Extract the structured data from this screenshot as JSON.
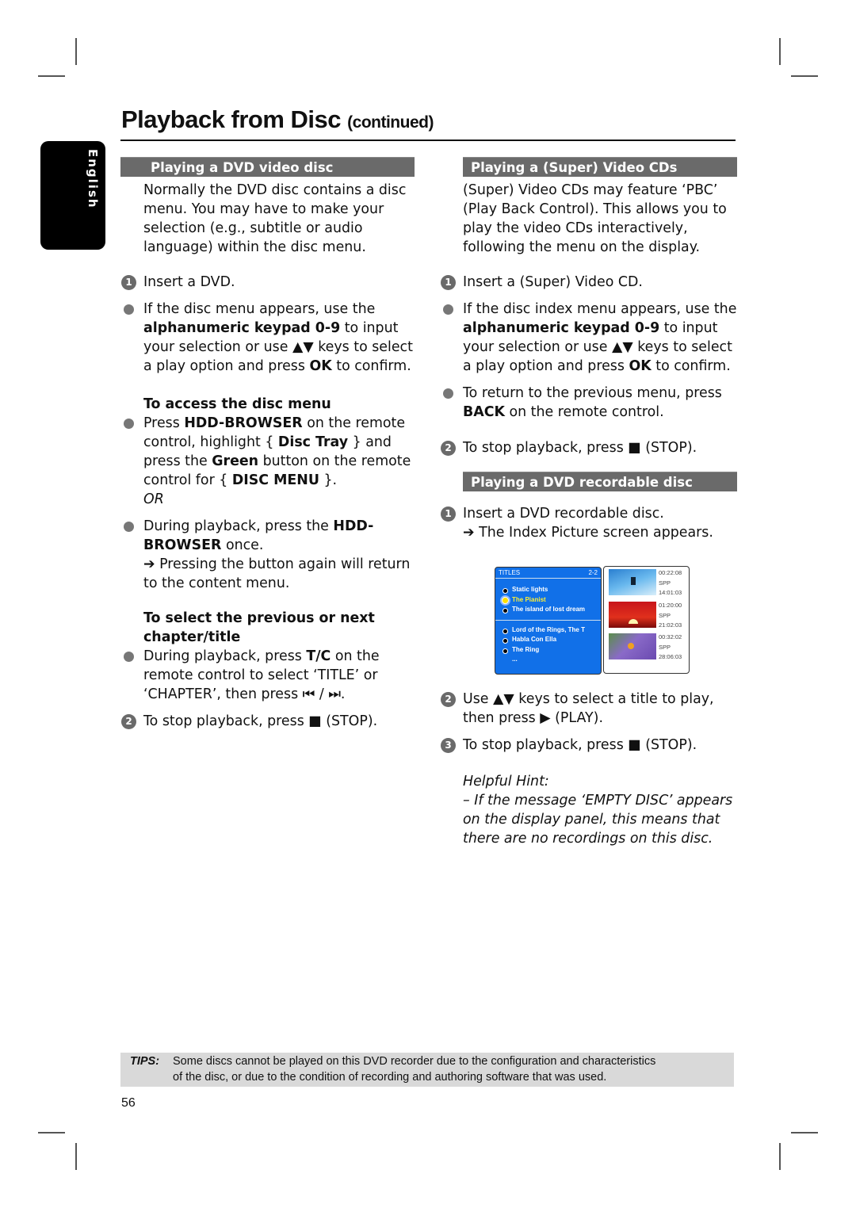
{
  "page": {
    "title": "Playback from Disc",
    "title_suffix": "(continued)",
    "language_tab": "English",
    "page_number": "56"
  },
  "left": {
    "header": "Playing a DVD video disc",
    "intro": "Normally the DVD disc contains a disc menu. You may have to make your selection (e.g., subtitle or audio language) within the disc menu.",
    "step1": "Insert a DVD.",
    "bullet1": {
      "pre": "If the disc menu appears, use the ",
      "b1": "alphanumeric keypad 0-9",
      "mid": " to input your selection or use ▲▼ keys to select a play option and press ",
      "b2": "OK",
      "post": " to confirm."
    },
    "sub1": "To access the disc menu",
    "bullet2": {
      "pre": "Press ",
      "b1": "HDD-BROWSER",
      "m1": " on the remote control, highlight { ",
      "b2": "Disc Tray",
      "m2": " } and press the ",
      "b3": "Green",
      "m3": " button on the remote control for { ",
      "b4": "DISC MENU",
      "post": " }."
    },
    "or": "OR",
    "bullet3": {
      "pre": "During playback, press the ",
      "b1": "HDD-BROWSER",
      "post": " once."
    },
    "bullet3_result": "➔ Pressing the button again will return to the content menu.",
    "sub2": "To select the previous or next chapter/title",
    "bullet4": {
      "pre": "During playback, press ",
      "b1": "T/C",
      "post": " on the remote control to select ‘TITLE’ or ‘CHAPTER’, then press ⏮ / ⏭."
    },
    "step2": "To stop playback, press ■ (STOP)."
  },
  "right": {
    "header": "Playing a (Super) Video CDs",
    "intro": "(Super) Video CDs may feature ‘PBC’ (Play Back Control). This allows you to play the video CDs interactively, following the menu on the display.",
    "step1": "Insert a (Super) Video CD.",
    "bullet1": {
      "pre": "If the disc index menu appears, use the ",
      "b1": "alphanumeric keypad 0-9",
      "mid": " to input your selection or use ▲▼ keys to select a play option and press ",
      "b2": "OK",
      "post": " to confirm."
    },
    "bullet2": {
      "b1": "BACK",
      "pre": "To return to the previous menu, press ",
      "post": " on the remote control."
    },
    "step2": "To stop playback, press ■ (STOP).",
    "header2": "Playing a DVD recordable disc",
    "r_step1": "Insert a DVD recordable disc.",
    "r_step1_result": "➔ The Index Picture screen appears.",
    "r_step2": "Use ▲▼ keys to select a title to play, then press ▶ (PLAY).",
    "r_step3": "To stop playback, press ■ (STOP).",
    "hint_title": "Helpful Hint:",
    "hint_text": "– If the message ‘EMPTY DISC’ appears on the display panel, this means that there are no recordings on this disc."
  },
  "index_screen": {
    "heading": "TITLES",
    "page": "2-2",
    "group1": [
      "Static lights",
      "The Pianist",
      "The island of lost dream"
    ],
    "selected": "The Pianist",
    "group2": [
      "Lord of the Rings, The T",
      "Habla Con Ella",
      "The Ring",
      "..."
    ],
    "thumbnails": [
      {
        "duration": "00:22:08",
        "mode": "SPP",
        "date": "14:01:03"
      },
      {
        "duration": "01:20:00",
        "mode": "SPP",
        "date": "21:02:03"
      },
      {
        "duration": "00:32:02",
        "mode": "SPP",
        "date": "28:06:03"
      }
    ]
  },
  "tips": {
    "label": "TIPS:",
    "line1": "Some discs cannot be played on this DVD recorder due to the configuration and characteristics",
    "line2": "of the disc, or due to the condition of recording and authoring software that was used."
  }
}
